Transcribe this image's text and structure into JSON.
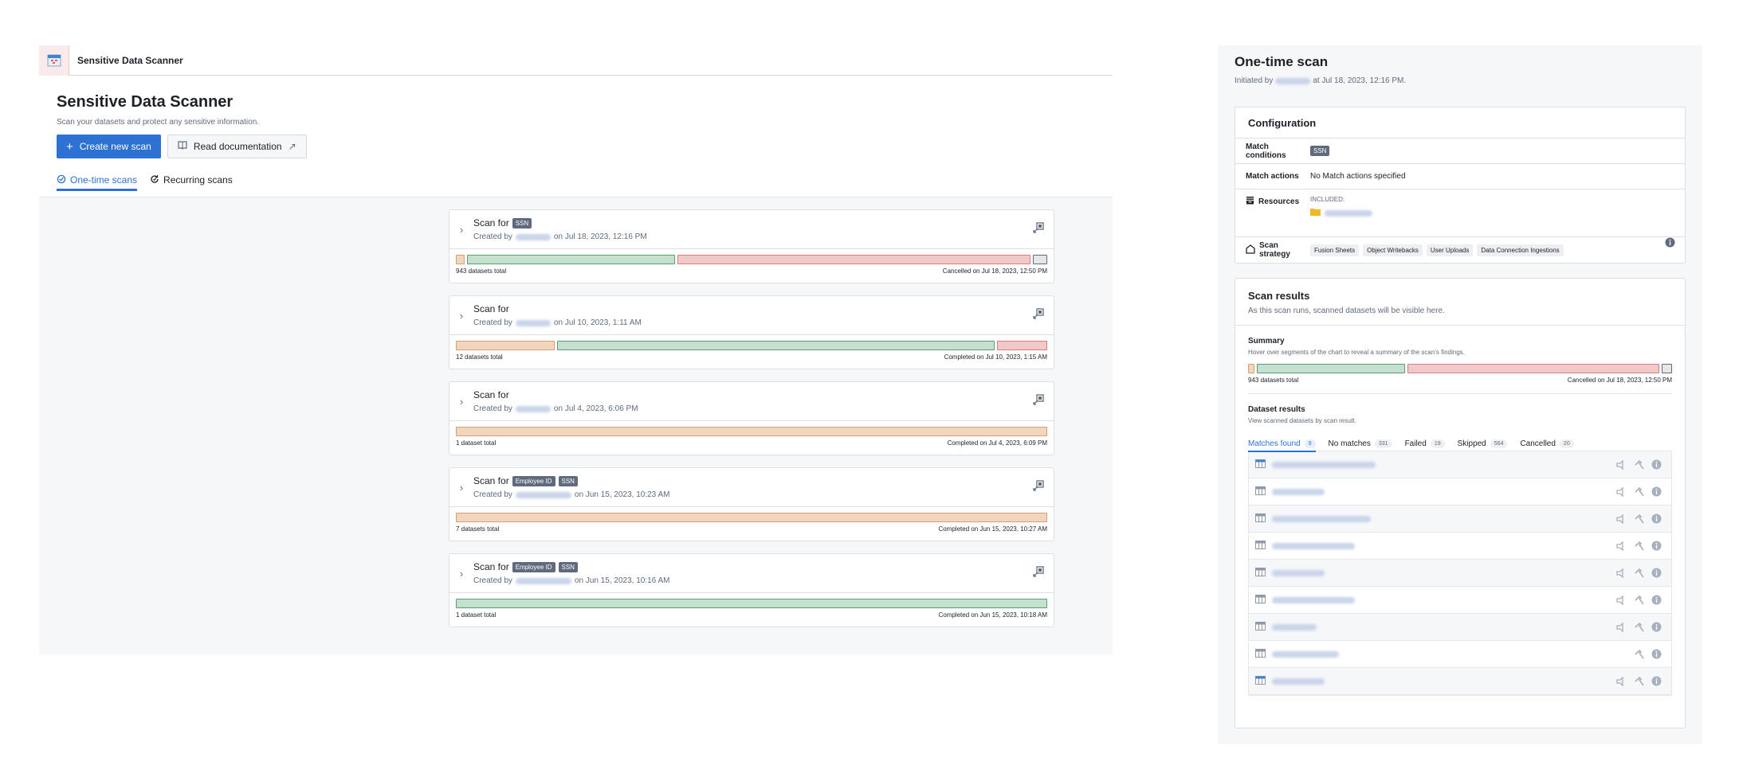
{
  "app": {
    "name": "Sensitive Data Scanner",
    "title": "Sensitive Data Scanner",
    "subtitle": "Scan your datasets and protect any sensitive information.",
    "create_button": "Create new scan",
    "docs_button": "Read documentation",
    "tabs": [
      {
        "label": "One-time scans",
        "icon": "check-circle-icon",
        "active": true
      },
      {
        "label": "Recurring scans",
        "icon": "refresh-icon",
        "active": false
      }
    ]
  },
  "colors": {
    "primary": "#2d72d2",
    "matches": "#f0d5bf",
    "no_matches": "#c6e0cf",
    "skipped": "#f2c8c9",
    "cancelled": "#e4e6e8"
  },
  "scans": [
    {
      "title": "Scan for",
      "tags": [
        "SSN"
      ],
      "created_prefix": "Created by",
      "created_on": "on Jul 18, 2023, 12:16 PM",
      "total": "943 datasets total",
      "status": "Cancelled on Jul 18, 2023, 12:50 PM",
      "segments": [
        {
          "type": "match",
          "value": 9
        },
        {
          "type": "nomatch",
          "value": 331
        },
        {
          "type": "skip",
          "value": 564
        },
        {
          "type": "cancel",
          "value": 20
        }
      ]
    },
    {
      "title": "Scan for",
      "tags": [],
      "created_prefix": "Created by",
      "created_on": "on Jul 10, 2023, 1:11 AM",
      "total": "12 datasets total",
      "status": "Completed on Jul 10, 2023, 1:15 AM",
      "segments": [
        {
          "type": "match",
          "value": 2
        },
        {
          "type": "nomatch",
          "value": 9
        },
        {
          "type": "skip",
          "value": 1
        }
      ]
    },
    {
      "title": "Scan for",
      "tags": [],
      "created_prefix": "Created by",
      "created_on": "on Jul 4, 2023, 6:06 PM",
      "total": "1 dataset total",
      "status": "Completed on Jul 4, 2023, 6:09 PM",
      "segments": [
        {
          "type": "match",
          "value": 1
        }
      ]
    },
    {
      "title": "Scan for",
      "tags": [
        "Employee ID",
        "SSN"
      ],
      "created_prefix": "Created by",
      "created_on": "on Jun 15, 2023, 10:23 AM",
      "total": "7 datasets total",
      "status": "Completed on Jun 15, 2023, 10:27 AM",
      "segments": [
        {
          "type": "match",
          "value": 7
        }
      ]
    },
    {
      "title": "Scan for",
      "tags": [
        "Employee ID",
        "SSN"
      ],
      "created_prefix": "Created by",
      "created_on": "on Jun 15, 2023, 10:16 AM",
      "total": "1 dataset total",
      "status": "Completed on Jun 15, 2023, 10:18 AM",
      "segments": [
        {
          "type": "nomatch",
          "value": 1
        }
      ]
    }
  ],
  "panel": {
    "title": "One-time scan",
    "initiated_prefix": "Initiated by",
    "initiated_suffix": "at Jul 18, 2023, 12:16 PM.",
    "configuration": {
      "title": "Configuration",
      "match_conditions_label": "Match conditions",
      "match_conditions": [
        "SSN"
      ],
      "match_actions_label": "Match actions",
      "match_actions_value": "No Match actions specified",
      "resources_label": "Resources",
      "included_label": "INCLUDED:",
      "scan_strategy_label": "Scan strategy",
      "scan_strategy": [
        "Fusion Sheets",
        "Object Writebacks",
        "User Uploads",
        "Data Connection Ingestions"
      ]
    },
    "results": {
      "title": "Scan results",
      "subtitle": "As this scan runs, scanned datasets will be visible here.",
      "summary_title": "Summary",
      "summary_subtitle": "Hover over segments of the chart to reveal a summary of the scan's findings.",
      "total": "943 datasets total",
      "status": "Cancelled on Jul 18, 2023, 12:50 PM",
      "dataset_results_title": "Dataset results",
      "dataset_results_subtitle": "View scanned datasets by scan result.",
      "tabs": [
        {
          "label": "Matches found",
          "count": "9",
          "active": true
        },
        {
          "label": "No matches",
          "count": "331",
          "active": false
        },
        {
          "label": "Failed",
          "count": "19",
          "active": false
        },
        {
          "label": "Skipped",
          "count": "564",
          "active": false
        },
        {
          "label": "Cancelled",
          "count": "20",
          "active": false
        }
      ],
      "datasets": [
        {
          "name_redacted": true,
          "actions": [
            "announce",
            "build",
            "info"
          ]
        },
        {
          "name_redacted": true,
          "actions": [
            "announce",
            "build",
            "info"
          ]
        },
        {
          "name_redacted": true,
          "actions": [
            "announce",
            "build",
            "info"
          ]
        },
        {
          "name_redacted": true,
          "actions": [
            "announce",
            "build",
            "info"
          ]
        },
        {
          "name_redacted": true,
          "actions": [
            "announce",
            "build",
            "info"
          ]
        },
        {
          "name_redacted": true,
          "actions": [
            "announce",
            "build",
            "info"
          ]
        },
        {
          "name_redacted": true,
          "actions": [
            "announce",
            "build",
            "info"
          ]
        },
        {
          "name_redacted": true,
          "actions": [
            "build",
            "info"
          ]
        },
        {
          "name_redacted": true,
          "actions": [
            "announce",
            "build",
            "info"
          ]
        }
      ]
    }
  }
}
